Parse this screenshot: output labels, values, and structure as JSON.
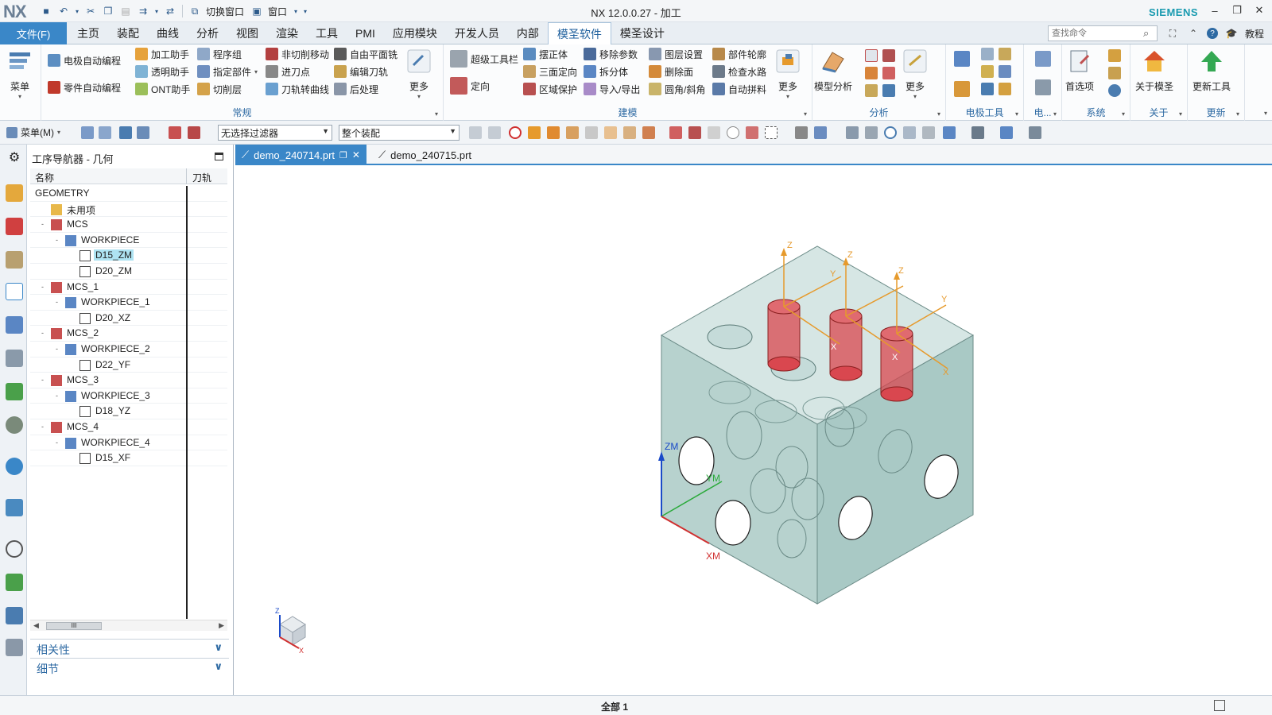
{
  "titlebar": {
    "logo": "NX",
    "title": "NX 12.0.0.27 - 加工",
    "brand": "SIEMENS",
    "switch_window": "切换窗口",
    "window": "窗口"
  },
  "menubar": {
    "file": "文件(F)",
    "tabs": [
      "主页",
      "装配",
      "曲线",
      "分析",
      "视图",
      "渲染",
      "工具",
      "PMI",
      "应用模块",
      "开发人员",
      "内部",
      "模圣软件",
      "模圣设计"
    ],
    "active_tab": "模圣软件",
    "search_placeholder": "查找命令",
    "help": "教程"
  },
  "ribbon": {
    "menu_big": "菜单",
    "g1": {
      "label": "常规",
      "items": [
        "电极自动编程",
        "零件自动编程",
        "加工助手",
        "透明助手",
        "ONT助手",
        "程序组",
        "指定部件",
        "切削层",
        "非切削移动",
        "进刀点",
        "刀轨转曲线",
        "自由平面铣",
        "编辑刀轨",
        "后处理"
      ],
      "more": "更多"
    },
    "g2": {
      "label": "建模",
      "items": [
        "超级工具栏",
        "定向",
        "摆正体",
        "三面定向",
        "区域保护",
        "移除参数",
        "拆分体",
        "导入/导出",
        "图层设置",
        "删除面",
        "圆角/斜角",
        "部件轮廓",
        "检查水路",
        "自动拼料"
      ],
      "more": "更多"
    },
    "g3": {
      "label": "分析",
      "model_analysis": "模型分析",
      "more": "更多"
    },
    "g4": {
      "label": "电极工具"
    },
    "g5": {
      "label": "电..."
    },
    "g6": {
      "label": "系统",
      "prefs": "首选项"
    },
    "g7": {
      "label": "关于",
      "about": "关于模圣"
    },
    "g8": {
      "label": "更新",
      "update": "更新工具"
    }
  },
  "cmdbar": {
    "menu": "菜单(M)",
    "filter": "无选择过滤器",
    "scope": "整个装配"
  },
  "navigator": {
    "title": "工序导航器 - 几何",
    "col_name": "名称",
    "col_path": "刀轨",
    "tree": [
      {
        "label": "GEOMETRY",
        "level": 0,
        "icon": "none"
      },
      {
        "label": "未用项",
        "level": 1,
        "icon": "folder"
      },
      {
        "label": "MCS",
        "level": 1,
        "icon": "mcs",
        "toggle": "-"
      },
      {
        "label": "WORKPIECE",
        "level": 2,
        "icon": "workpiece",
        "toggle": "-"
      },
      {
        "label": "D15_ZM",
        "level": 3,
        "icon": "operation",
        "selected": true
      },
      {
        "label": "D20_ZM",
        "level": 3,
        "icon": "operation"
      },
      {
        "label": "MCS_1",
        "level": 1,
        "icon": "mcs",
        "toggle": "-"
      },
      {
        "label": "WORKPIECE_1",
        "level": 2,
        "icon": "workpiece",
        "toggle": "-"
      },
      {
        "label": "D20_XZ",
        "level": 3,
        "icon": "operation"
      },
      {
        "label": "MCS_2",
        "level": 1,
        "icon": "mcs",
        "toggle": "-"
      },
      {
        "label": "WORKPIECE_2",
        "level": 2,
        "icon": "workpiece",
        "toggle": "-"
      },
      {
        "label": "D22_YF",
        "level": 3,
        "icon": "operation"
      },
      {
        "label": "MCS_3",
        "level": 1,
        "icon": "mcs",
        "toggle": "-"
      },
      {
        "label": "WORKPIECE_3",
        "level": 2,
        "icon": "workpiece",
        "toggle": "-"
      },
      {
        "label": "D18_YZ",
        "level": 3,
        "icon": "operation"
      },
      {
        "label": "MCS_4",
        "level": 1,
        "icon": "mcs",
        "toggle": "-"
      },
      {
        "label": "WORKPIECE_4",
        "level": 2,
        "icon": "workpiece",
        "toggle": "-"
      },
      {
        "label": "D15_XF",
        "level": 3,
        "icon": "operation"
      }
    ],
    "panels": [
      "相关性",
      "细节"
    ],
    "scroll_thumb": "III"
  },
  "documents": {
    "tabs": [
      "demo_240714.prt",
      "demo_240715.prt"
    ],
    "active": "demo_240714.prt"
  },
  "graphics": {
    "axis_labels": {
      "z": "Z",
      "y": "Y",
      "x": "X",
      "zm": "ZM",
      "ym": "YM",
      "xm": "XM"
    }
  },
  "status": {
    "text": "全部 1"
  },
  "colors": {
    "accent": "#3a87c8",
    "brand": "#1a9bb0",
    "part": "#a9c9c5",
    "red_tool": "#d9474f",
    "orange_axis": "#e69a2c"
  }
}
